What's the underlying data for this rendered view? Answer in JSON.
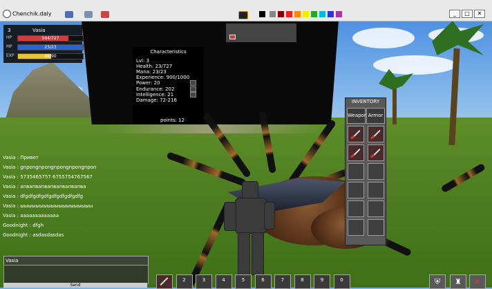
{
  "window": {
    "title": "Chenchik.daly",
    "controls": [
      "_",
      "□",
      "✕"
    ]
  },
  "colors": {
    "health": "#d23c3c",
    "mana": "#2a62d8",
    "experience": "#e6c53a",
    "inventory_bg": "#595959"
  },
  "player": {
    "level": "3",
    "name": "Vasia",
    "stats": [
      {
        "label": "HP",
        "value": "564/727",
        "fraction": 0.78,
        "color": "#d23c3c"
      },
      {
        "label": "MP",
        "value": "23/23",
        "fraction": 1.0,
        "color": "#2a62d8"
      },
      {
        "label": "EXP",
        "value": "46/90",
        "fraction": 0.51,
        "color": "#e6c53a"
      }
    ]
  },
  "characteristics": {
    "title": "Characteristics",
    "lines": [
      "Lvl: 3",
      "Health: 23/727",
      "Mana: 23/23",
      "Experience: 900/1000",
      "Power: 20",
      "Endurance: 202",
      "Intelligence: 21",
      "Damage: 72-216"
    ],
    "points": "points: 12"
  },
  "inventory": {
    "title": "INVENTORY",
    "tabs": [
      "Weapon",
      "Armor"
    ],
    "slots": [
      {
        "item": "sword-icon"
      },
      {
        "item": "sword-icon"
      },
      {
        "item": "sword-icon"
      },
      {
        "item": "sword-icon"
      },
      {
        "item": null
      },
      {
        "item": null
      },
      {
        "item": null
      },
      {
        "item": null
      },
      {
        "item": null
      },
      {
        "item": null
      },
      {
        "item": null
      },
      {
        "item": null
      }
    ]
  },
  "chat": {
    "lines": [
      "Vasia : Привет",
      "Vasia : gnpongnpongnpongnpongnpon",
      "Vasia : 5735465757 6755754767567",
      "Vasia : апвапвапвапвапвапвапва",
      "Vasia : dfgdfgdfgdfgdfgdfgdfgdfg",
      "Vasia : ыыыыыыыыыыыыыыыыыыы",
      "Vasia : aaaaaaaaaaaaa",
      "Goodnight : dfgh",
      "Goodnight : asdasdasdas"
    ],
    "input_value": "Vasia",
    "send_label": "Send"
  },
  "hotbar": {
    "slots": [
      "",
      "2",
      "3",
      "4",
      "5",
      "6",
      "7",
      "8",
      "9",
      "0"
    ]
  },
  "bottom_right": [
    {
      "name": "shield-icon",
      "glyph": "⛨"
    },
    {
      "name": "bag-icon",
      "glyph": "♜"
    },
    {
      "name": "close-icon",
      "glyph": "✕"
    }
  ]
}
